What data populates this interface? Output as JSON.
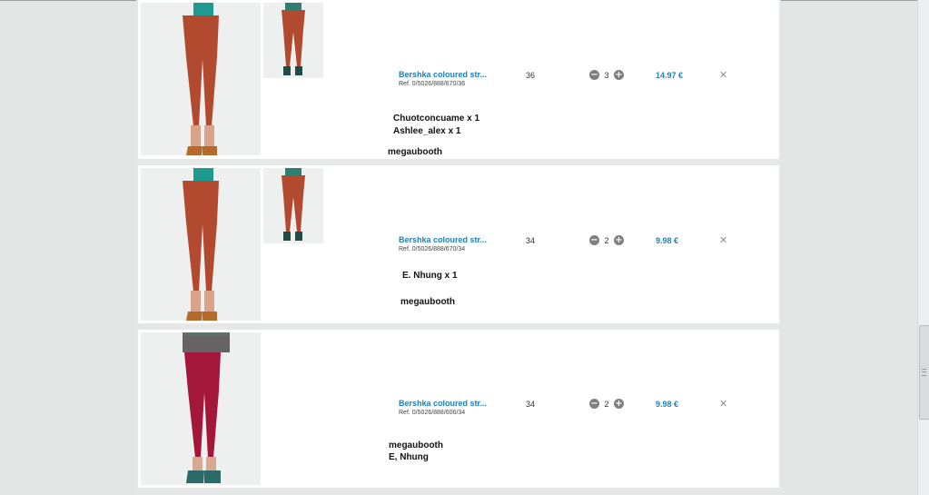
{
  "colors": {
    "link": "#1f7fb7",
    "card": "#ffffff",
    "background": "#e4e6e6"
  },
  "icons": {
    "decrement": "minus-circle-icon",
    "increment": "plus-circle-icon",
    "remove": "close-icon"
  },
  "glyphs": {
    "minus": "−",
    "plus": "+",
    "remove": "✕"
  },
  "items": [
    {
      "name": "Bershka coloured str...",
      "ref": "Ref. 0/5026/888/670/36",
      "size": "36",
      "qty": "3",
      "price": "14.97 €",
      "pants_color": "#b24a2f",
      "notes": [
        "Chuotconcuame x 1",
        "Ashlee_alex x 1",
        "megaubooth"
      ]
    },
    {
      "name": "Bershka coloured str...",
      "ref": "Ref. 0/5026/888/670/34",
      "size": "34",
      "qty": "2",
      "price": "9.98 €",
      "pants_color": "#b24a2f",
      "notes": [
        "E. Nhung x 1",
        "megaubooth"
      ]
    },
    {
      "name": "Bershka coloured str...",
      "ref": "Ref. 0/5026/888/606/34",
      "size": "34",
      "qty": "2",
      "price": "9.98 €",
      "pants_color": "#a3173a",
      "notes": [
        "megaubooth",
        "E, Nhung"
      ]
    }
  ]
}
